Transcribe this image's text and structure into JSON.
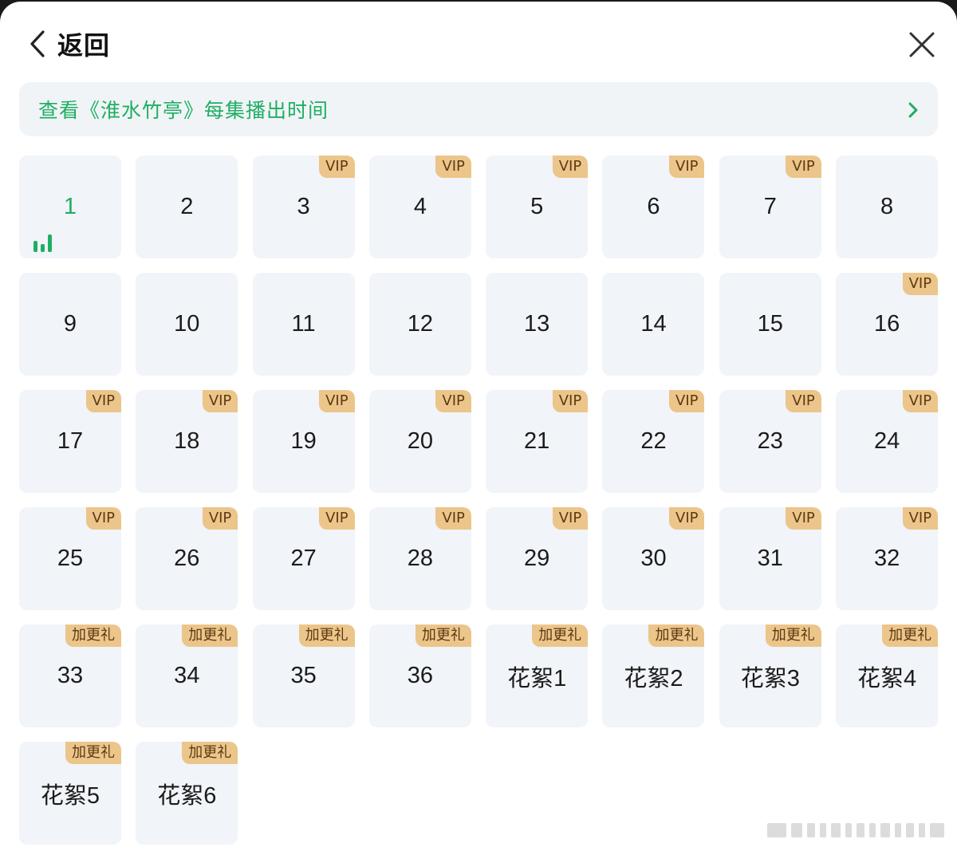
{
  "header": {
    "back_label": "返回",
    "back_icon": "chevron-left-icon",
    "close_icon": "close-icon"
  },
  "banner": {
    "text": "查看《淮水竹亭》每集播出时间",
    "arrow_icon": "chevron-right-icon"
  },
  "colors": {
    "accent_green": "#1fae63",
    "tile_bg": "#f1f4f8",
    "tag_bg": "#ecc58a",
    "tag_text": "#5c3a13"
  },
  "episodes": [
    {
      "label": "1",
      "tag": "",
      "current": true
    },
    {
      "label": "2",
      "tag": ""
    },
    {
      "label": "3",
      "tag": "VIP"
    },
    {
      "label": "4",
      "tag": "VIP"
    },
    {
      "label": "5",
      "tag": "VIP"
    },
    {
      "label": "6",
      "tag": "VIP"
    },
    {
      "label": "7",
      "tag": "VIP"
    },
    {
      "label": "8",
      "tag": ""
    },
    {
      "label": "9",
      "tag": ""
    },
    {
      "label": "10",
      "tag": ""
    },
    {
      "label": "11",
      "tag": ""
    },
    {
      "label": "12",
      "tag": ""
    },
    {
      "label": "13",
      "tag": ""
    },
    {
      "label": "14",
      "tag": ""
    },
    {
      "label": "15",
      "tag": ""
    },
    {
      "label": "16",
      "tag": "VIP"
    },
    {
      "label": "17",
      "tag": "VIP"
    },
    {
      "label": "18",
      "tag": "VIP"
    },
    {
      "label": "19",
      "tag": "VIP"
    },
    {
      "label": "20",
      "tag": "VIP"
    },
    {
      "label": "21",
      "tag": "VIP"
    },
    {
      "label": "22",
      "tag": "VIP"
    },
    {
      "label": "23",
      "tag": "VIP"
    },
    {
      "label": "24",
      "tag": "VIP"
    },
    {
      "label": "25",
      "tag": "VIP"
    },
    {
      "label": "26",
      "tag": "VIP"
    },
    {
      "label": "27",
      "tag": "VIP"
    },
    {
      "label": "28",
      "tag": "VIP"
    },
    {
      "label": "29",
      "tag": "VIP"
    },
    {
      "label": "30",
      "tag": "VIP"
    },
    {
      "label": "31",
      "tag": "VIP"
    },
    {
      "label": "32",
      "tag": "VIP"
    },
    {
      "label": "33",
      "tag": "加更礼"
    },
    {
      "label": "34",
      "tag": "加更礼"
    },
    {
      "label": "35",
      "tag": "加更礼"
    },
    {
      "label": "36",
      "tag": "加更礼"
    },
    {
      "label": "花絮1",
      "tag": "加更礼"
    },
    {
      "label": "花絮2",
      "tag": "加更礼"
    },
    {
      "label": "花絮3",
      "tag": "加更礼"
    },
    {
      "label": "花絮4",
      "tag": "加更礼"
    },
    {
      "label": "花絮5",
      "tag": "加更礼"
    },
    {
      "label": "花絮6",
      "tag": "加更礼"
    }
  ]
}
